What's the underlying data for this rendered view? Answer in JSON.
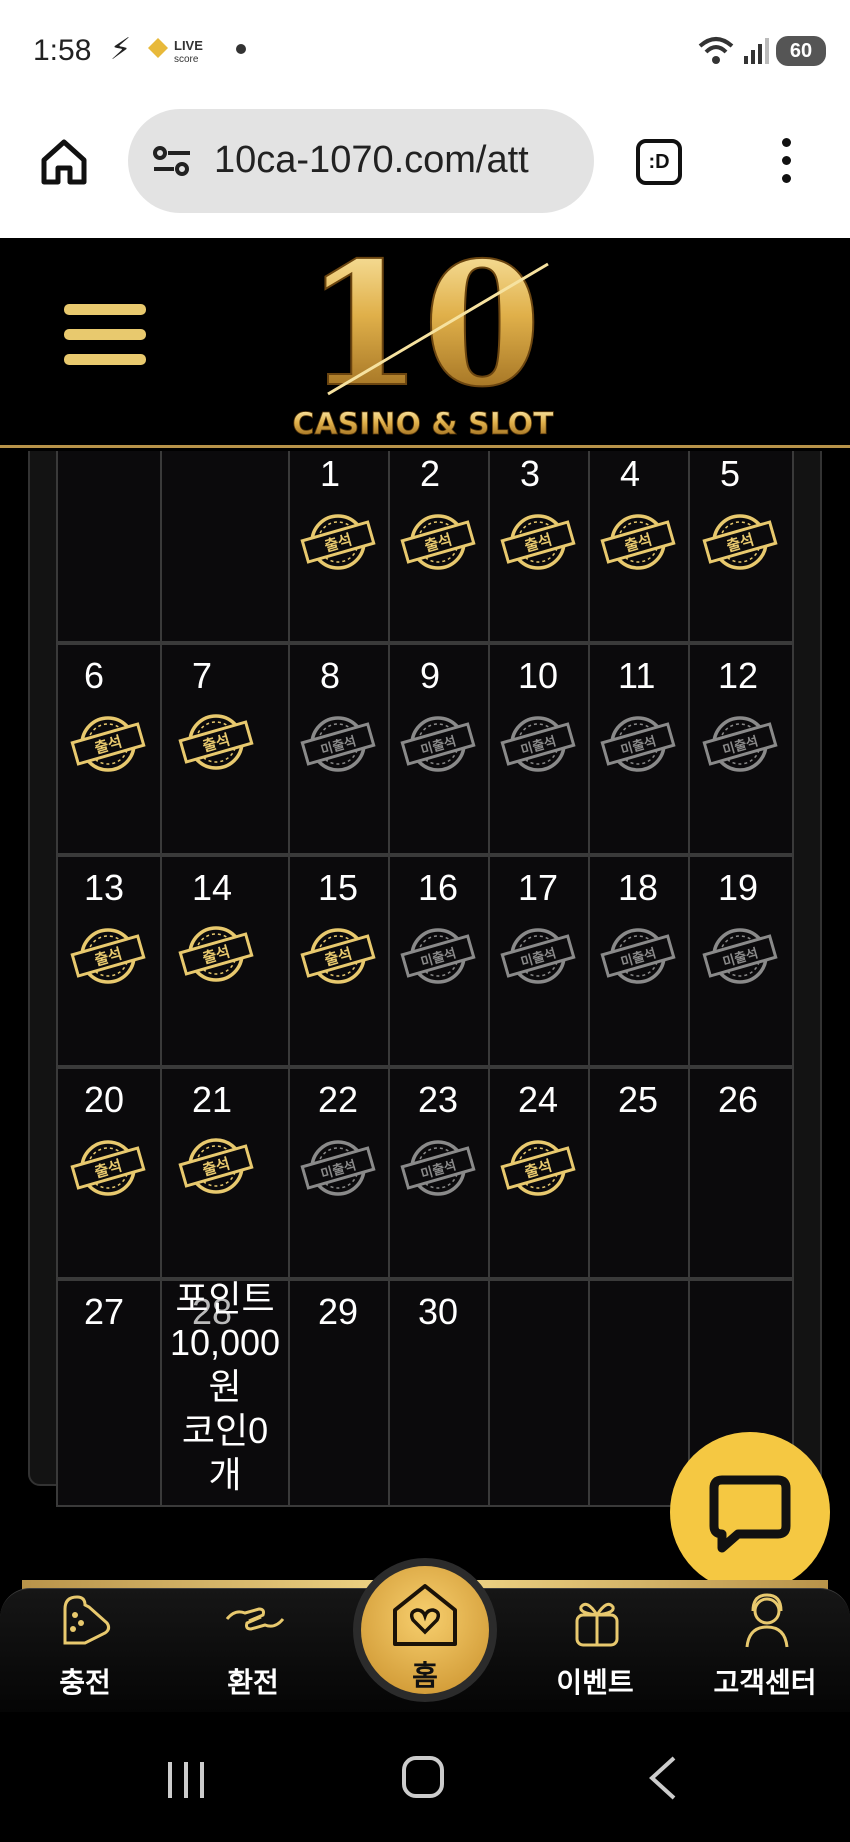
{
  "status_bar": {
    "time": "1:58",
    "live_badge": "LIVE",
    "live_sub": "score",
    "battery": "60"
  },
  "browser": {
    "url": "10ca-1070.com/att",
    "tab_icon_label": ":D"
  },
  "site": {
    "logo_number": "10",
    "logo_text": "CASINO & SLOT"
  },
  "stamps": {
    "attended": "출석",
    "not_attended": "미출석"
  },
  "calendar": {
    "weeks": [
      [
        {
          "day": ""
        },
        {
          "day": ""
        },
        {
          "day": "1",
          "status": "attended"
        },
        {
          "day": "2",
          "status": "attended"
        },
        {
          "day": "3",
          "status": "attended"
        },
        {
          "day": "4",
          "status": "attended"
        },
        {
          "day": "5",
          "status": "attended"
        }
      ],
      [
        {
          "day": "6",
          "status": "attended"
        },
        {
          "day": "7",
          "status": "attended"
        },
        {
          "day": "8",
          "status": "missed"
        },
        {
          "day": "9",
          "status": "missed"
        },
        {
          "day": "10",
          "status": "missed"
        },
        {
          "day": "11",
          "status": "missed"
        },
        {
          "day": "12",
          "status": "missed"
        }
      ],
      [
        {
          "day": "13",
          "status": "attended"
        },
        {
          "day": "14",
          "status": "attended"
        },
        {
          "day": "15",
          "status": "attended"
        },
        {
          "day": "16",
          "status": "missed"
        },
        {
          "day": "17",
          "status": "missed"
        },
        {
          "day": "18",
          "status": "missed"
        },
        {
          "day": "19",
          "status": "missed"
        }
      ],
      [
        {
          "day": "20",
          "status": "attended"
        },
        {
          "day": "21",
          "status": "attended"
        },
        {
          "day": "22",
          "status": "missed"
        },
        {
          "day": "23",
          "status": "missed"
        },
        {
          "day": "24",
          "status": "attended"
        },
        {
          "day": "25"
        },
        {
          "day": "26"
        }
      ],
      [
        {
          "day": "27"
        },
        {
          "day": "28",
          "note": "포인트\n10,000\n원\n코인0\n개"
        },
        {
          "day": "29"
        },
        {
          "day": "30"
        },
        {
          "day": ""
        },
        {
          "day": ""
        },
        {
          "day": ""
        }
      ]
    ]
  },
  "bottom_nav": {
    "charge": "충전",
    "exchange": "환전",
    "home": "홈",
    "event": "이벤트",
    "support": "고객센터"
  },
  "colors": {
    "gold": "#e8c96e",
    "gold_dark": "#b8934a",
    "missed_gray": "#8a8a8a",
    "chat_yellow": "#f5c842"
  }
}
